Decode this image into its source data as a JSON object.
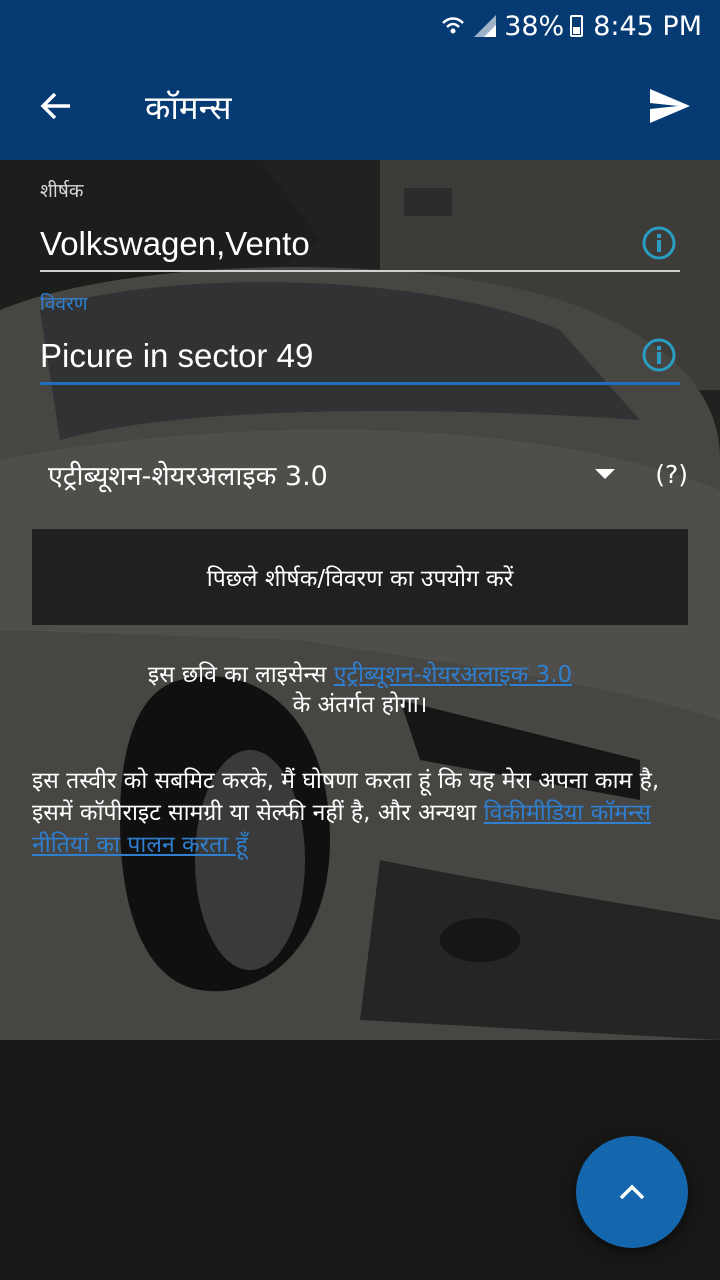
{
  "status_bar": {
    "battery": "38%",
    "time": "8:45 PM"
  },
  "app_bar": {
    "title": "कॉमन्स"
  },
  "form": {
    "title_label": "शीर्षक",
    "title_value": "Volkswagen,Vento",
    "description_label": "विवरण",
    "description_value": "Picure  in sector 49",
    "license_selected": "एट्रीब्यूशन-शेयरअलाइक 3.0",
    "license_help": "(?)",
    "previous_button": "पिछले शीर्षक/विवरण का उपयोग करें"
  },
  "license_text": {
    "prefix": "इस छवि का लाइसेन्स ",
    "link": "एट्रीब्यूशन-शेयरअलाइक 3.0",
    "suffix": "के अंतर्गत होगा।"
  },
  "declaration": {
    "text": "इस तस्वीर को सबमिट करके, मैं घोषणा करता हूं कि यह मेरा अपना काम है, इसमें कॉपीराइट सामग्री या सेल्फी नहीं है, और अन्यथा ",
    "link": "विकीमीडिया कॉमन्स नीतियां का पालन करता हूँ"
  },
  "colors": {
    "primary": "#053a73",
    "accent": "#1466ad",
    "link": "#2f7fd1"
  },
  "icons": [
    "wifi-icon",
    "signal-icon",
    "battery-icon",
    "back-arrow-icon",
    "send-icon",
    "info-icon",
    "dropdown-arrow-icon",
    "chevron-up-icon"
  ]
}
